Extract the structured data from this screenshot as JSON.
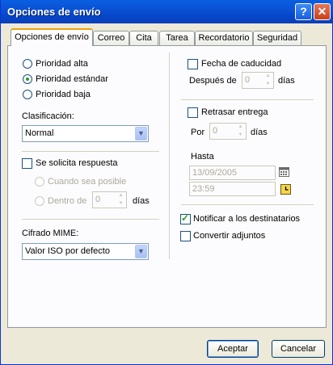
{
  "window": {
    "title": "Opciones de envío"
  },
  "titlebar": {
    "help": "?",
    "close": "✕"
  },
  "tabs": [
    {
      "label": "Opciones de envío"
    },
    {
      "label": "Correo"
    },
    {
      "label": "Cita"
    },
    {
      "label": "Tarea"
    },
    {
      "label": "Recordatorio"
    },
    {
      "label": "Seguridad"
    }
  ],
  "priority": {
    "high": "Prioridad alta",
    "standard": "Prioridad estándar",
    "low": "Prioridad baja",
    "selected": "standard"
  },
  "classification": {
    "label": "Clasificación:",
    "value": "Normal"
  },
  "reply": {
    "label": "Se solicita respuesta",
    "checked": false,
    "when_possible": "Cuando sea posible",
    "within": "Dentro de",
    "days_value": "0",
    "days_unit": "días"
  },
  "mime": {
    "label": "Cifrado MIME:",
    "value": "Valor ISO por defecto"
  },
  "expiration": {
    "label": "Fecha de caducidad",
    "checked": false,
    "after": "Después de",
    "value": "0",
    "unit": "días"
  },
  "delay": {
    "label": "Retrasar entrega",
    "checked": false,
    "by": "Por",
    "value": "0",
    "unit": "días"
  },
  "until": {
    "label": "Hasta",
    "date": "13/09/2005",
    "time": "23:59"
  },
  "notify": {
    "label": "Notificar a los destinatarios",
    "checked": true
  },
  "convert": {
    "label": "Convertir adjuntos",
    "checked": false
  },
  "buttons": {
    "ok": "Aceptar",
    "cancel": "Cancelar"
  }
}
